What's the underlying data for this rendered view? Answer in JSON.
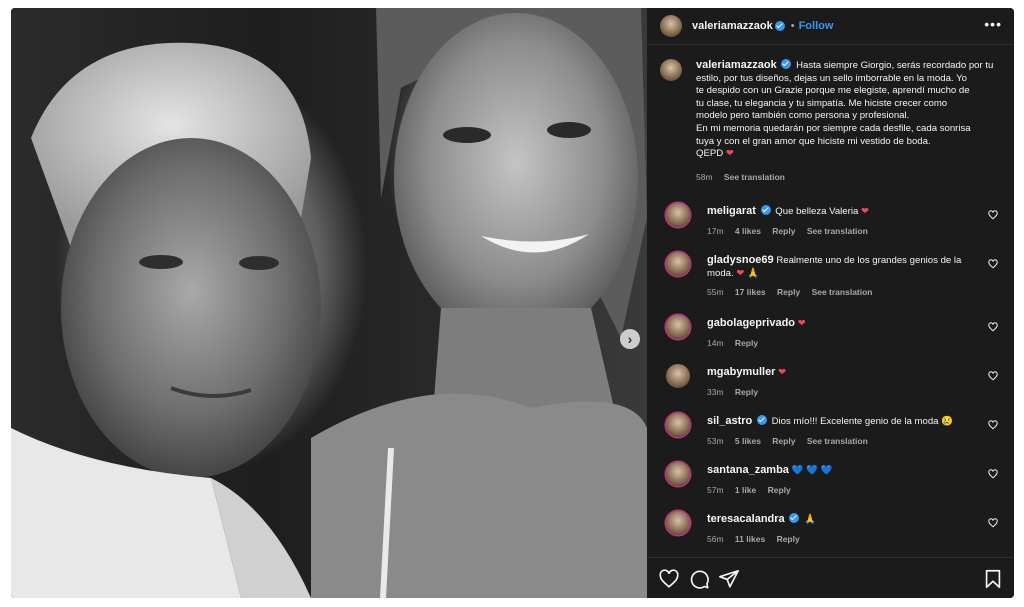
{
  "post": {
    "author": "valeriamazzaok",
    "follow_label": "Follow",
    "separator": "•",
    "more_label": "•••",
    "caption_lines": [
      "Hasta siempre Giorgio, serás recordado por tu",
      "estilo, por tus diseños, dejas un sello imborrable en la moda. Yo",
      "te despido con un Grazie porque me elegiste, aprendí mucho de",
      "tu clase, tu elegancia y tu simpatía. Me hiciste crecer como",
      "modelo pero también como persona y profesional.",
      "En mi memoria quedarán por siempre cada desfile, cada sonrisa",
      "tuya y con el gran amor que hiciste mi vestido de boda.",
      "QEPD"
    ],
    "caption_time": "58m",
    "see_translation": "See translation"
  },
  "carousel": {
    "next_label": "›"
  },
  "comments": [
    {
      "user": "meligarat",
      "verified": true,
      "lines": [
        "Que belleza Valeria"
      ],
      "emoji": "❤",
      "emoji_class": "emoji-heart",
      "time": "17m",
      "likes": "4 likes",
      "reply": "Reply",
      "translate": "See translation",
      "ring": true
    },
    {
      "user": "gladysnoe69",
      "verified": false,
      "lines": [
        "Realmente uno de los grandes genios de la",
        "moda."
      ],
      "emoji": "❤ 🙏",
      "emoji_class": "emoji-heart",
      "time": "55m",
      "likes": "17 likes",
      "reply": "Reply",
      "translate": "See translation",
      "ring": true
    },
    {
      "user": "gabolageprivado",
      "verified": false,
      "lines": [
        ""
      ],
      "emoji": "❤",
      "emoji_class": "emoji-heart",
      "time": "14m",
      "likes": "",
      "reply": "Reply",
      "translate": "",
      "ring": true
    },
    {
      "user": "mgabymuller",
      "verified": false,
      "lines": [
        ""
      ],
      "emoji": "❤",
      "emoji_class": "emoji-heart",
      "time": "33m",
      "likes": "",
      "reply": "Reply",
      "translate": "",
      "ring": false
    },
    {
      "user": "sil_astro",
      "verified": true,
      "lines": [
        "Dios mío!!! Excelente genio de la moda"
      ],
      "emoji": "😢",
      "emoji_class": "emoji-yel",
      "time": "53m",
      "likes": "5 likes",
      "reply": "Reply",
      "translate": "See translation",
      "ring": true
    },
    {
      "user": "santana_zamba",
      "verified": false,
      "lines": [
        ""
      ],
      "emoji": "💙 💙 💙",
      "emoji_class": "emoji-blue",
      "time": "57m",
      "likes": "1 like",
      "reply": "Reply",
      "translate": "",
      "ring": true
    },
    {
      "user": "teresacalandra",
      "verified": true,
      "lines": [
        ""
      ],
      "emoji": "🙏",
      "emoji_class": "emoji-yel",
      "time": "56m",
      "likes": "11 likes",
      "reply": "Reply",
      "translate": "",
      "ring": true
    }
  ],
  "icons": {
    "like": "heart-icon",
    "comment": "comment-icon",
    "share": "share-icon",
    "save": "bookmark-icon"
  },
  "colors": {
    "accent": "#3897f0",
    "heart": "#ed4956",
    "panel_bg": "#1b1b1b",
    "muted": "#a8a8a8"
  }
}
